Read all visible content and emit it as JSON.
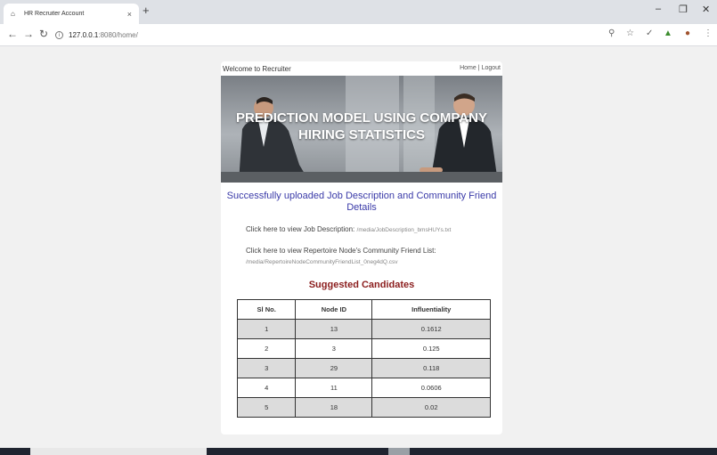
{
  "browser": {
    "tab_title": "HR Recruiter Account",
    "tab_close": "×",
    "new_tab": "+",
    "url_host": "127.0.0.1",
    "url_path": ":8080/home/",
    "controls": {
      "minimize": "–",
      "maximize": "❐",
      "close": "✕"
    }
  },
  "page": {
    "welcome": "Welcome to Recruiter",
    "nav": {
      "home": "Home",
      "separator": "|",
      "logout": "Logout"
    },
    "banner_title": "PREDICTION MODEL USING COMPANY HIRING STATISTICS",
    "success_message": "Successfully uploaded Job Description and Community Friend Details",
    "job_desc_label": "Click here to view Job Description:",
    "job_desc_path": "/media/JobDescription_bmsHUYs.txt",
    "community_label": "Click here to view Repertoire Node's Community Friend List:",
    "community_path": "/media/RepertoireNodeCommunityFriendList_0neg4dQ.csv",
    "suggested_title": "Suggested Candidates",
    "table": {
      "headers": [
        "Sl No.",
        "Node ID",
        "Influentiality"
      ],
      "rows": [
        [
          "1",
          "13",
          "0.1612"
        ],
        [
          "2",
          "3",
          "0.125"
        ],
        [
          "3",
          "29",
          "0.118"
        ],
        [
          "4",
          "11",
          "0.0606"
        ],
        [
          "5",
          "18",
          "0.02"
        ]
      ]
    }
  },
  "colors": {
    "success": "#3a3aa8",
    "suggested": "#8b1d1d",
    "row_alt": "#dcdcdc"
  }
}
